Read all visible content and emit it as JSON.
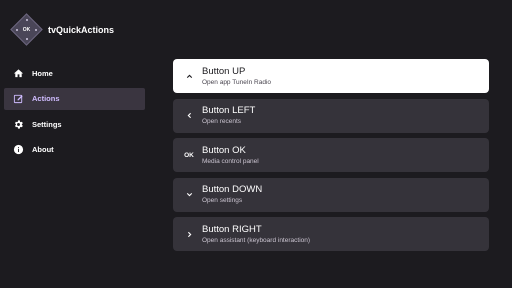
{
  "app": {
    "title": "tvQuickActions",
    "logo_text": "OK"
  },
  "sidebar": {
    "items": [
      {
        "label": "Home",
        "icon": "home-icon",
        "active": false
      },
      {
        "label": "Actions",
        "icon": "edit-icon",
        "active": true
      },
      {
        "label": "Settings",
        "icon": "gear-icon",
        "active": false
      },
      {
        "label": "About",
        "icon": "info-icon",
        "active": false
      }
    ]
  },
  "buttons": [
    {
      "title": "Button UP",
      "subtitle": "Open app TuneIn Radio",
      "icon": "chevron-up-icon",
      "focused": true
    },
    {
      "title": "Button LEFT",
      "subtitle": "Open recents",
      "icon": "chevron-left-icon",
      "focused": false
    },
    {
      "title": "Button OK",
      "subtitle": "Media control panel",
      "icon": "ok-text-icon",
      "icon_text": "OK",
      "focused": false
    },
    {
      "title": "Button DOWN",
      "subtitle": "Open settings",
      "icon": "chevron-down-icon",
      "focused": false
    },
    {
      "title": "Button RIGHT",
      "subtitle": "Open assistant (keyboard interaction)",
      "icon": "chevron-right-icon",
      "focused": false
    }
  ],
  "colors": {
    "background": "#1c1b1f",
    "card": "#35333a",
    "card_focused": "#ffffff",
    "accent": "#d0bcff"
  }
}
